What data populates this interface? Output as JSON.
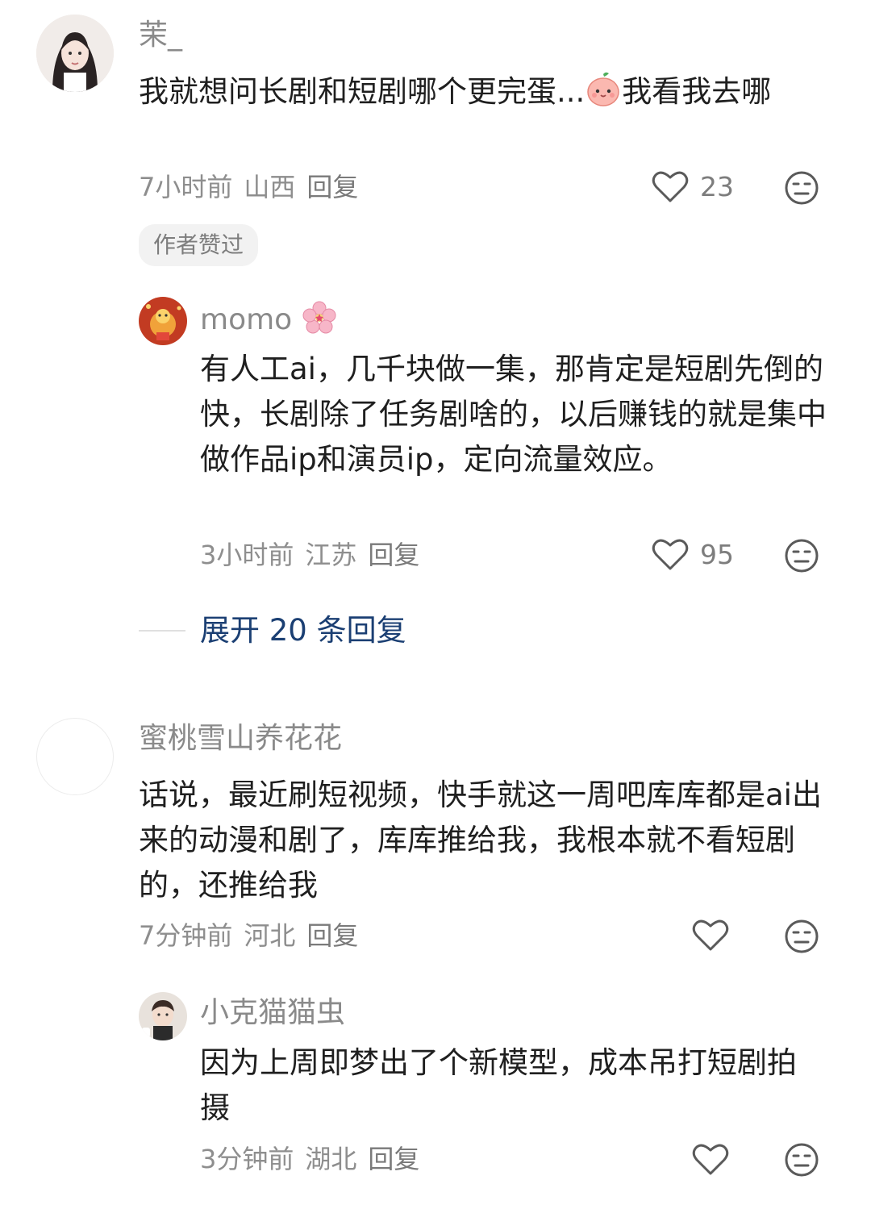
{
  "comments": [
    {
      "name": "茉_",
      "text_before": "我就想问长剧和短剧哪个更完蛋...",
      "text_after": "我看我去哪",
      "emoji": "peach-face-emoji",
      "time": "7小时前",
      "location": "山西",
      "reply_label": "回复",
      "likes": "23",
      "tag": "作者赞过",
      "replies": [
        {
          "name": "momo",
          "name_emoji": "cherry-blossom-emoji",
          "text": "有人工ai，几千块做一集，那肯定是短剧先倒的快，长剧除了任务剧啥的，以后赚钱的就是集中做作品ip和演员ip，定向流量效应。",
          "time": "3小时前",
          "location": "江苏",
          "reply_label": "回复",
          "likes": "95"
        }
      ],
      "expand_label": "展开 20 条回复"
    },
    {
      "name": "蜜桃雪山养花花",
      "text": "话说，最近刷短视频，快手就这一周吧库库都是ai出来的动漫和剧了，库库推给我，我根本就不看短剧的，还推给我",
      "time": "7分钟前",
      "location": "河北",
      "reply_label": "回复",
      "replies": [
        {
          "name": "小克猫猫虫",
          "text": "因为上周即梦出了个新模型，成本吊打短剧拍摄",
          "time": "3分钟前",
          "location": "湖北",
          "reply_label": "回复"
        }
      ]
    }
  ],
  "icons": {
    "like": "heart-outline-icon",
    "dislike": "unamused-face-icon"
  },
  "colors": {
    "expand_link": "#1b3f73",
    "meta_text": "#8e8e8e",
    "tag_bg": "#f2f2f2"
  }
}
